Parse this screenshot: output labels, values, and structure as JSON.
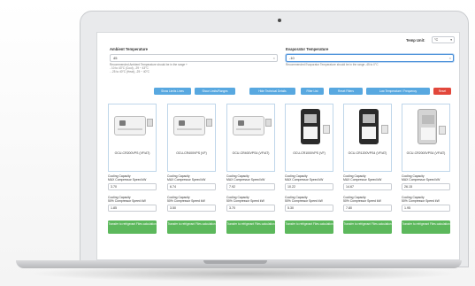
{
  "header": {
    "temp_unit_label": "Temp Unit:",
    "temp_unit_value": "°C"
  },
  "form": {
    "ambient": {
      "label": "Ambient Temperature",
      "value": "45",
      "hint1": "Recommended Ambient Temperature should be in the range +",
      "hint2": "- 10 to 43°C (Cool), -29 ~ 43°C",
      "hint3": "- -25 to 40°C (Heat), -25 ~ 40°C"
    },
    "evaporator": {
      "label": "Evaporator Temperature",
      "value": "-10",
      "hint": "Recommended Evaporator Temperature should be in the range -45 to 0°C"
    }
  },
  "actions": [
    {
      "label": "Show Limits Lines",
      "color": "#58a8e0"
    },
    {
      "label": "Show Limits/Ranges",
      "color": "#58a8e0"
    },
    {
      "label": "Hide Technical Details",
      "color": "#58a8e0"
    },
    {
      "label": "Filter List",
      "color": "#58a8e0"
    },
    {
      "label": "Reset Filters",
      "color": "#58a8e0"
    },
    {
      "label": "Low Temperature / Frequency",
      "color": "#58a8e0"
    },
    {
      "label": "Reset",
      "color": "#e2473b"
    }
  ],
  "cards": [
    {
      "name": "OCU-CR200VPS (VF/AT)",
      "cap_label": "Cooling Capacity",
      "cap_sub": "MAX Compressor Speed kW",
      "cap_value": "3.70",
      "eff_label": "Cooling Capacity",
      "eff_sub": "50% Compressor Speed kW",
      "eff_value": "1.85",
      "button": "Transfer to refrigerant Files calculation",
      "type": "wide"
    },
    {
      "name": "OCU-CR400VPS (VF)",
      "cap_label": "Cooling Capacity",
      "cap_sub": "MAX Compressor Speed kW",
      "cap_value": "6.74",
      "eff_label": "Cooling Capacity",
      "eff_sub": "50% Compressor Speed kW",
      "eff_value": "3.50",
      "button": "Transfer to refrigerant Files calculation",
      "type": "wide"
    },
    {
      "name": "OCU-CR400VPS4 (VF/AT)",
      "cap_label": "Cooling Capacity",
      "cap_sub": "MAX Compressor Speed kW",
      "cap_value": "7.92",
      "eff_label": "Cooling Capacity",
      "eff_sub": "50% Compressor Speed kW",
      "eff_value": "3.70",
      "button": "Transfer to refrigerant Files calculation",
      "type": "wide"
    },
    {
      "name": "OCU-CR1000VPS (VF)",
      "cap_label": "Cooling Capacity",
      "cap_sub": "MAX Compressor Speed kW",
      "cap_value": "10.22",
      "eff_label": "Cooling Capacity",
      "eff_sub": "50% Compressor Speed kW",
      "eff_value": "5.30",
      "button": "Transfer to refrigerant Files calculation",
      "type": "black"
    },
    {
      "name": "OCU-CR1200VPS4 (VF/AT)",
      "cap_label": "Cooling Capacity",
      "cap_sub": "MAX Compressor Speed kW",
      "cap_value": "14.67",
      "eff_label": "Cooling Capacity",
      "eff_sub": "50% Compressor Speed kW",
      "eff_value": "7.80",
      "button": "Transfer to refrigerant Files calculation",
      "type": "black"
    },
    {
      "name": "OCU-CR2000VPS4 (VF/AT)",
      "cap_label": "Cooling Capacity",
      "cap_sub": "MAX Compressor Speed kW",
      "cap_value": "26.15",
      "eff_label": "Cooling Capacity",
      "eff_sub": "50% Compressor Speed kW",
      "eff_value": "1.95",
      "button": "Transfer to refrigerant Files calculation",
      "type": "silver"
    }
  ]
}
